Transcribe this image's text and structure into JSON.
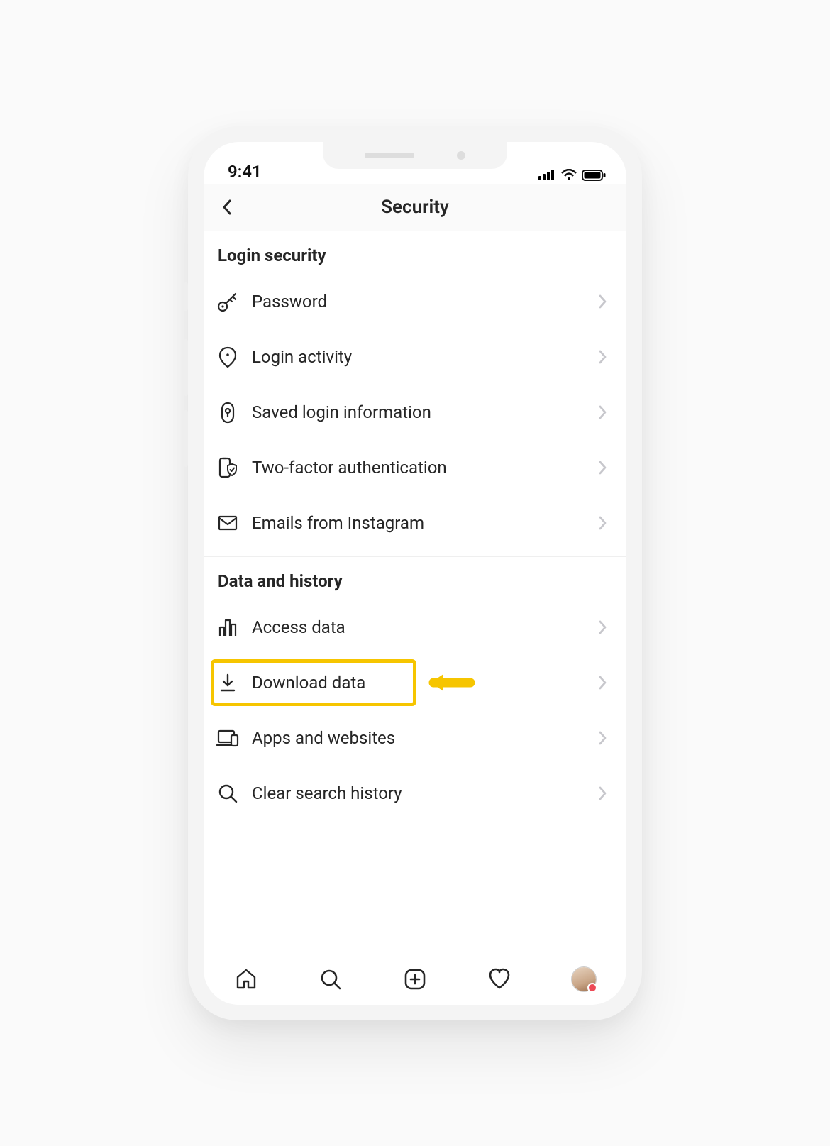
{
  "status": {
    "time": "9:41"
  },
  "header": {
    "title": "Security"
  },
  "sections": [
    {
      "title": "Login security",
      "items": [
        {
          "icon": "key",
          "label": "Password"
        },
        {
          "icon": "location",
          "label": "Login activity"
        },
        {
          "icon": "keyhole",
          "label": "Saved login information"
        },
        {
          "icon": "shieldphone",
          "label": "Two-factor authentication"
        },
        {
          "icon": "mail",
          "label": "Emails from Instagram"
        }
      ]
    },
    {
      "title": "Data and history",
      "items": [
        {
          "icon": "bars",
          "label": "Access data"
        },
        {
          "icon": "download",
          "label": "Download data",
          "highlighted": true
        },
        {
          "icon": "devices",
          "label": "Apps and websites"
        },
        {
          "icon": "search",
          "label": "Clear search history"
        }
      ]
    }
  ]
}
